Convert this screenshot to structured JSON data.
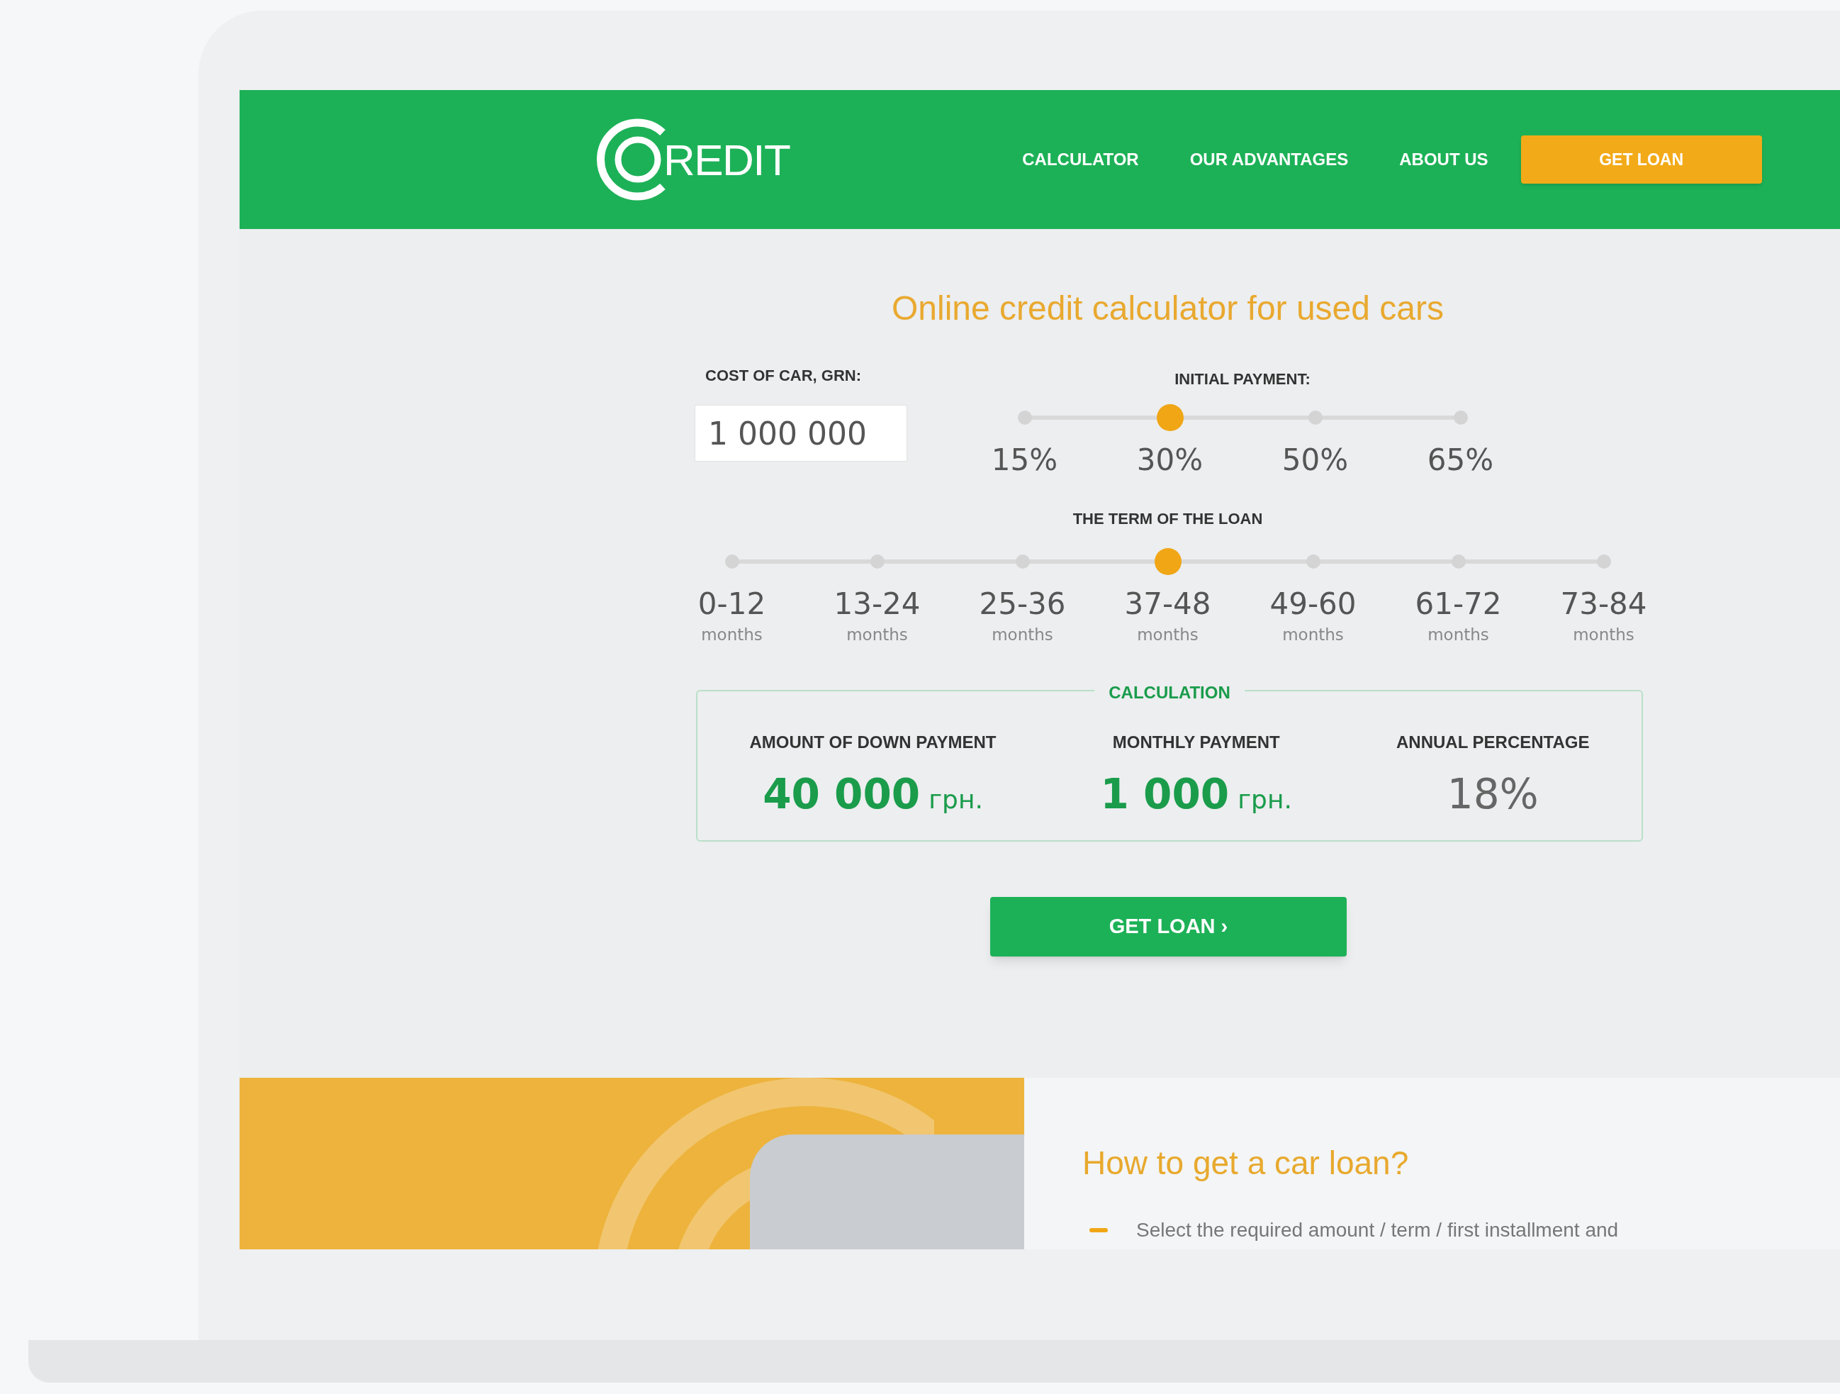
{
  "header": {
    "logo_text": "REDIT",
    "nav": [
      {
        "label": "CALCULATOR"
      },
      {
        "label": "OUR ADVANTAGES"
      },
      {
        "label": "ABOUT US"
      }
    ],
    "cta": "GET LOAN"
  },
  "calculator": {
    "title": "Online credit calculator for used cars",
    "cost": {
      "label": "COST OF CAR, GRN:",
      "value": "1 000 000"
    },
    "initial_payment": {
      "label": "INITIAL PAYMENT:",
      "options": [
        {
          "label": "15%",
          "selected": false
        },
        {
          "label": "30%",
          "selected": true
        },
        {
          "label": "50%",
          "selected": false
        },
        {
          "label": "65%",
          "selected": false
        }
      ]
    },
    "term": {
      "label": "THE TERM OF THE LOAN",
      "options": [
        {
          "label": "0-12",
          "unit": "months",
          "selected": false
        },
        {
          "label": "13-24",
          "unit": "months",
          "selected": false
        },
        {
          "label": "25-36",
          "unit": "months",
          "selected": false
        },
        {
          "label": "37-48",
          "unit": "months",
          "selected": true
        },
        {
          "label": "49-60",
          "unit": "months",
          "selected": false
        },
        {
          "label": "61-72",
          "unit": "months",
          "selected": false
        },
        {
          "label": "73-84",
          "unit": "months",
          "selected": false
        }
      ]
    },
    "calculation": {
      "legend": "CALCULATION",
      "items": [
        {
          "title": "AMOUNT OF DOWN PAYMENT",
          "value": "40 000",
          "unit": "грн.",
          "kind": "money"
        },
        {
          "title": "MONTHLY PAYMENT",
          "value": "1 000",
          "unit": "грн.",
          "kind": "money"
        },
        {
          "title": "ANNUAL PERCENTAGE",
          "value": "18%",
          "kind": "rate"
        }
      ]
    },
    "button": "GET LOAN ›"
  },
  "how_to": {
    "title": "How to get a car loan?",
    "steps": [
      "Select the required amount / term / first installment and"
    ]
  }
}
